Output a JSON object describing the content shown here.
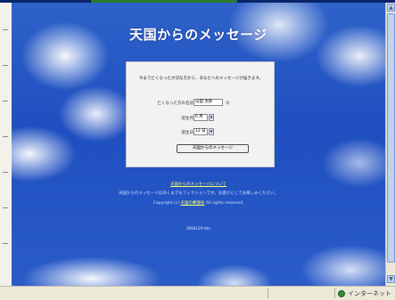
{
  "page": {
    "title": "天国からのメッセージ",
    "intro": "今まで亡くなった大切な方から、あなたへのメッセージが届きます。"
  },
  "form": {
    "name_label": "亡くなった方の名前",
    "name_value": "山田 太郎",
    "name_unit": "様",
    "month_label": "誕生月",
    "month_value": "6 月",
    "day_label": "誕生日",
    "day_value": "12 日",
    "submit_label": "天国からのメッセージ"
  },
  "footer": {
    "line1_link": "天国からのメッセージについて",
    "line2": "天国からのメッセージはあくまでもフィクションです。お遊びとしてお楽しみください。",
    "line3_prefix": "Copyright (c)",
    "line3_link": "天国の郵便局",
    "line3_suffix": "All rights reserved.",
    "counter": "0004129 hits"
  },
  "statusbar": {
    "zone_label": "インターネット"
  },
  "colors": {
    "sky": "#2a5cc8",
    "panel": "#f2f2f2",
    "link": "#ffff66"
  }
}
